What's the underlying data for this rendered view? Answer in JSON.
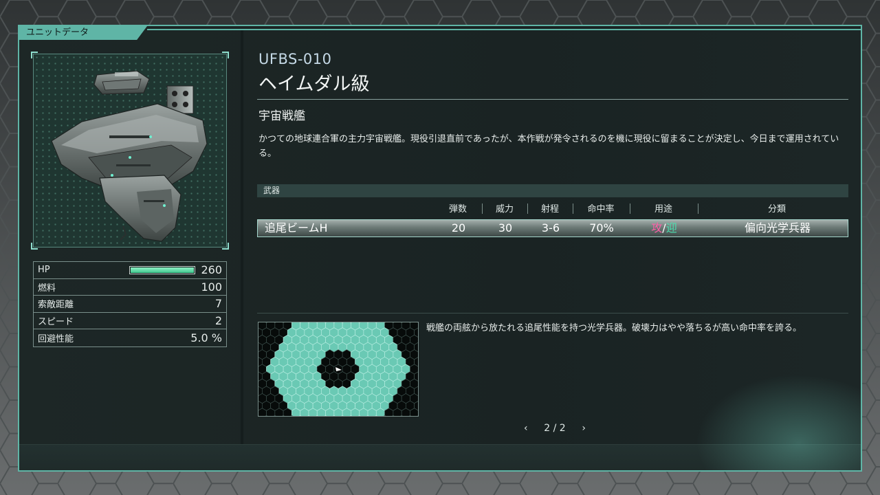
{
  "panel": {
    "title": "ユニットデータ"
  },
  "unit": {
    "code": "UFBS-010",
    "name": "ヘイムダル級",
    "category": "宇宙戦艦",
    "description": "かつての地球連合軍の主力宇宙戦艦。現役引退直前であったが、本作戦が発令されるのを機に現役に留まることが決定し、今日まで運用されている。"
  },
  "stats": {
    "hp": {
      "label": "HP",
      "value": "260",
      "bar_fraction": 1.0
    },
    "fuel": {
      "label": "燃料",
      "value": "100"
    },
    "search_range": {
      "label": "索敵距離",
      "value": "7"
    },
    "speed": {
      "label": "スピード",
      "value": "2"
    },
    "evasion": {
      "label": "回避性能",
      "value": "5.0 %"
    }
  },
  "weapons": {
    "header": "武器",
    "columns": {
      "ammo": "弾数",
      "power": "威力",
      "range": "射程",
      "accuracy": "命中率",
      "use": "用途",
      "type": "分類"
    },
    "rows": [
      {
        "name": "追尾ビームH",
        "ammo": "20",
        "power": "30",
        "range": "3-6",
        "accuracy": "70%",
        "use_attack": "攻",
        "use_sep": "/",
        "use_intercept": "迎",
        "type": "偏向光学兵器"
      }
    ]
  },
  "weapon_detail": {
    "description": "戦艦の両舷から放たれる追尾性能を持つ光学兵器。破壊力はやや落ちるが高い命中率を誇る。"
  },
  "pager": {
    "prev_icon": "chevron-left-icon",
    "text": "2 / 2",
    "next_icon": "chevron-right-icon"
  },
  "colors": {
    "accent": "#5fb5a6",
    "hp_bar": "#3fc88e",
    "attack": "#ff5fa8",
    "intercept": "#4be0b0",
    "range_fill": "#6ac9b4"
  }
}
